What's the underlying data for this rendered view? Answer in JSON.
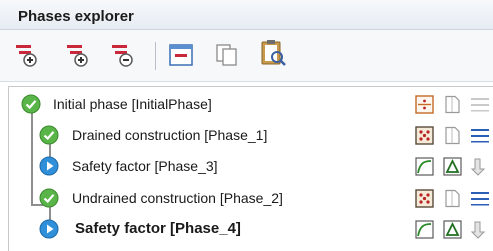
{
  "panel": {
    "title": "Phases explorer"
  },
  "toolbar": {
    "buttons": [
      {
        "name": "insert-phase",
        "icon": "add-phase-icon"
      },
      {
        "name": "add-phase",
        "icon": "add-phase-icon"
      },
      {
        "name": "delete-phase",
        "icon": "delete-phase-icon"
      },
      {
        "name": "edit-phase",
        "icon": "edit-phase-icon"
      },
      {
        "name": "copy-phase",
        "icon": "copy-icon"
      },
      {
        "name": "inspect-phase",
        "icon": "magnify-clipboard-icon"
      }
    ]
  },
  "phases": [
    {
      "label": "Initial phase [InitialPhase]",
      "status": "ok",
      "bold": false,
      "icons": [
        "k0-procedure-icon",
        "pore-pressure-icon",
        "water-level-icon"
      ]
    },
    {
      "label": "Drained construction [Phase_1]",
      "status": "ok",
      "bold": false,
      "icons": [
        "plastic-calculation-icon",
        "pore-pressure-icon",
        "water-level-icon"
      ]
    },
    {
      "label": "Safety factor [Phase_3]",
      "status": "pending",
      "bold": false,
      "icons": [
        "safety-factor-icon",
        "delta-icon",
        "arrow-down-icon"
      ]
    },
    {
      "label": "Undrained construction  [Phase_2]",
      "status": "ok",
      "bold": false,
      "icons": [
        "plastic-calculation-icon",
        "pore-pressure-icon",
        "water-level-icon"
      ]
    },
    {
      "label": "Safety factor [Phase_4]",
      "status": "pending",
      "bold": true,
      "icons": [
        "safety-factor-icon",
        "delta-icon",
        "arrow-down-icon"
      ]
    }
  ],
  "colors": {
    "ok_green": "#59b548",
    "pending_blue": "#2f8fd8",
    "toolbar_red": "#c8283a"
  }
}
